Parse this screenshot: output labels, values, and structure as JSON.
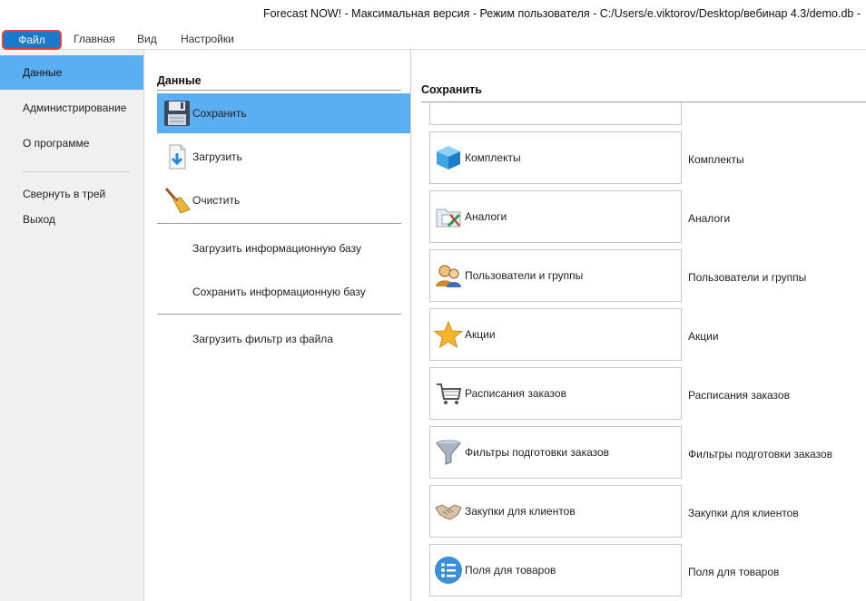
{
  "window": {
    "title": "Forecast NOW! - Максимальная версия - Режим пользователя - C:/Users/e.viktorov/Desktop/вебинар 4.3/demo.db -"
  },
  "menu": {
    "file": "Файл",
    "home": "Главная",
    "view": "Вид",
    "settings": "Настройки"
  },
  "left_nav": {
    "items": [
      "Данные",
      "Администрирование",
      "О программе"
    ],
    "extra": [
      "Свернуть в трей",
      "Выход"
    ],
    "active": "Данные"
  },
  "middle": {
    "header": "Данные",
    "commands": [
      {
        "label": "Сохранить",
        "icon": "floppy-disk-icon",
        "active": true
      },
      {
        "label": "Загрузить",
        "icon": "download-document-icon",
        "active": false
      },
      {
        "label": "Очистить",
        "icon": "broom-icon",
        "active": false
      }
    ],
    "links": [
      "Загрузить информационную базу",
      "Сохранить информационную базу",
      "Загрузить фильтр из файла"
    ]
  },
  "right": {
    "header": "Сохранить",
    "options": [
      {
        "label": "Комплекты",
        "desc": "Комплекты",
        "icon": "cube-icon"
      },
      {
        "label": "Аналоги",
        "desc": "Аналоги",
        "icon": "folder-analog-icon"
      },
      {
        "label": "Пользователи и группы",
        "desc": "Пользователи и группы",
        "icon": "users-icon"
      },
      {
        "label": "Акции",
        "desc": "Акции",
        "icon": "star-icon"
      },
      {
        "label": "Расписания заказов",
        "desc": "Расписания заказов",
        "icon": "cart-icon"
      },
      {
        "label": "Фильтры подготовки заказов",
        "desc": "Фильтры подготовки заказов",
        "icon": "funnel-icon"
      },
      {
        "label": "Закупки для клиентов",
        "desc": "Закупки для клиентов",
        "icon": "handshake-icon"
      },
      {
        "label": "Поля для товаров",
        "desc": "Поля для товаров",
        "icon": "list-icon"
      }
    ]
  },
  "colors": {
    "accent": "#1979ca",
    "highlight": "#5aaef2",
    "file_outline": "#e0443a"
  }
}
